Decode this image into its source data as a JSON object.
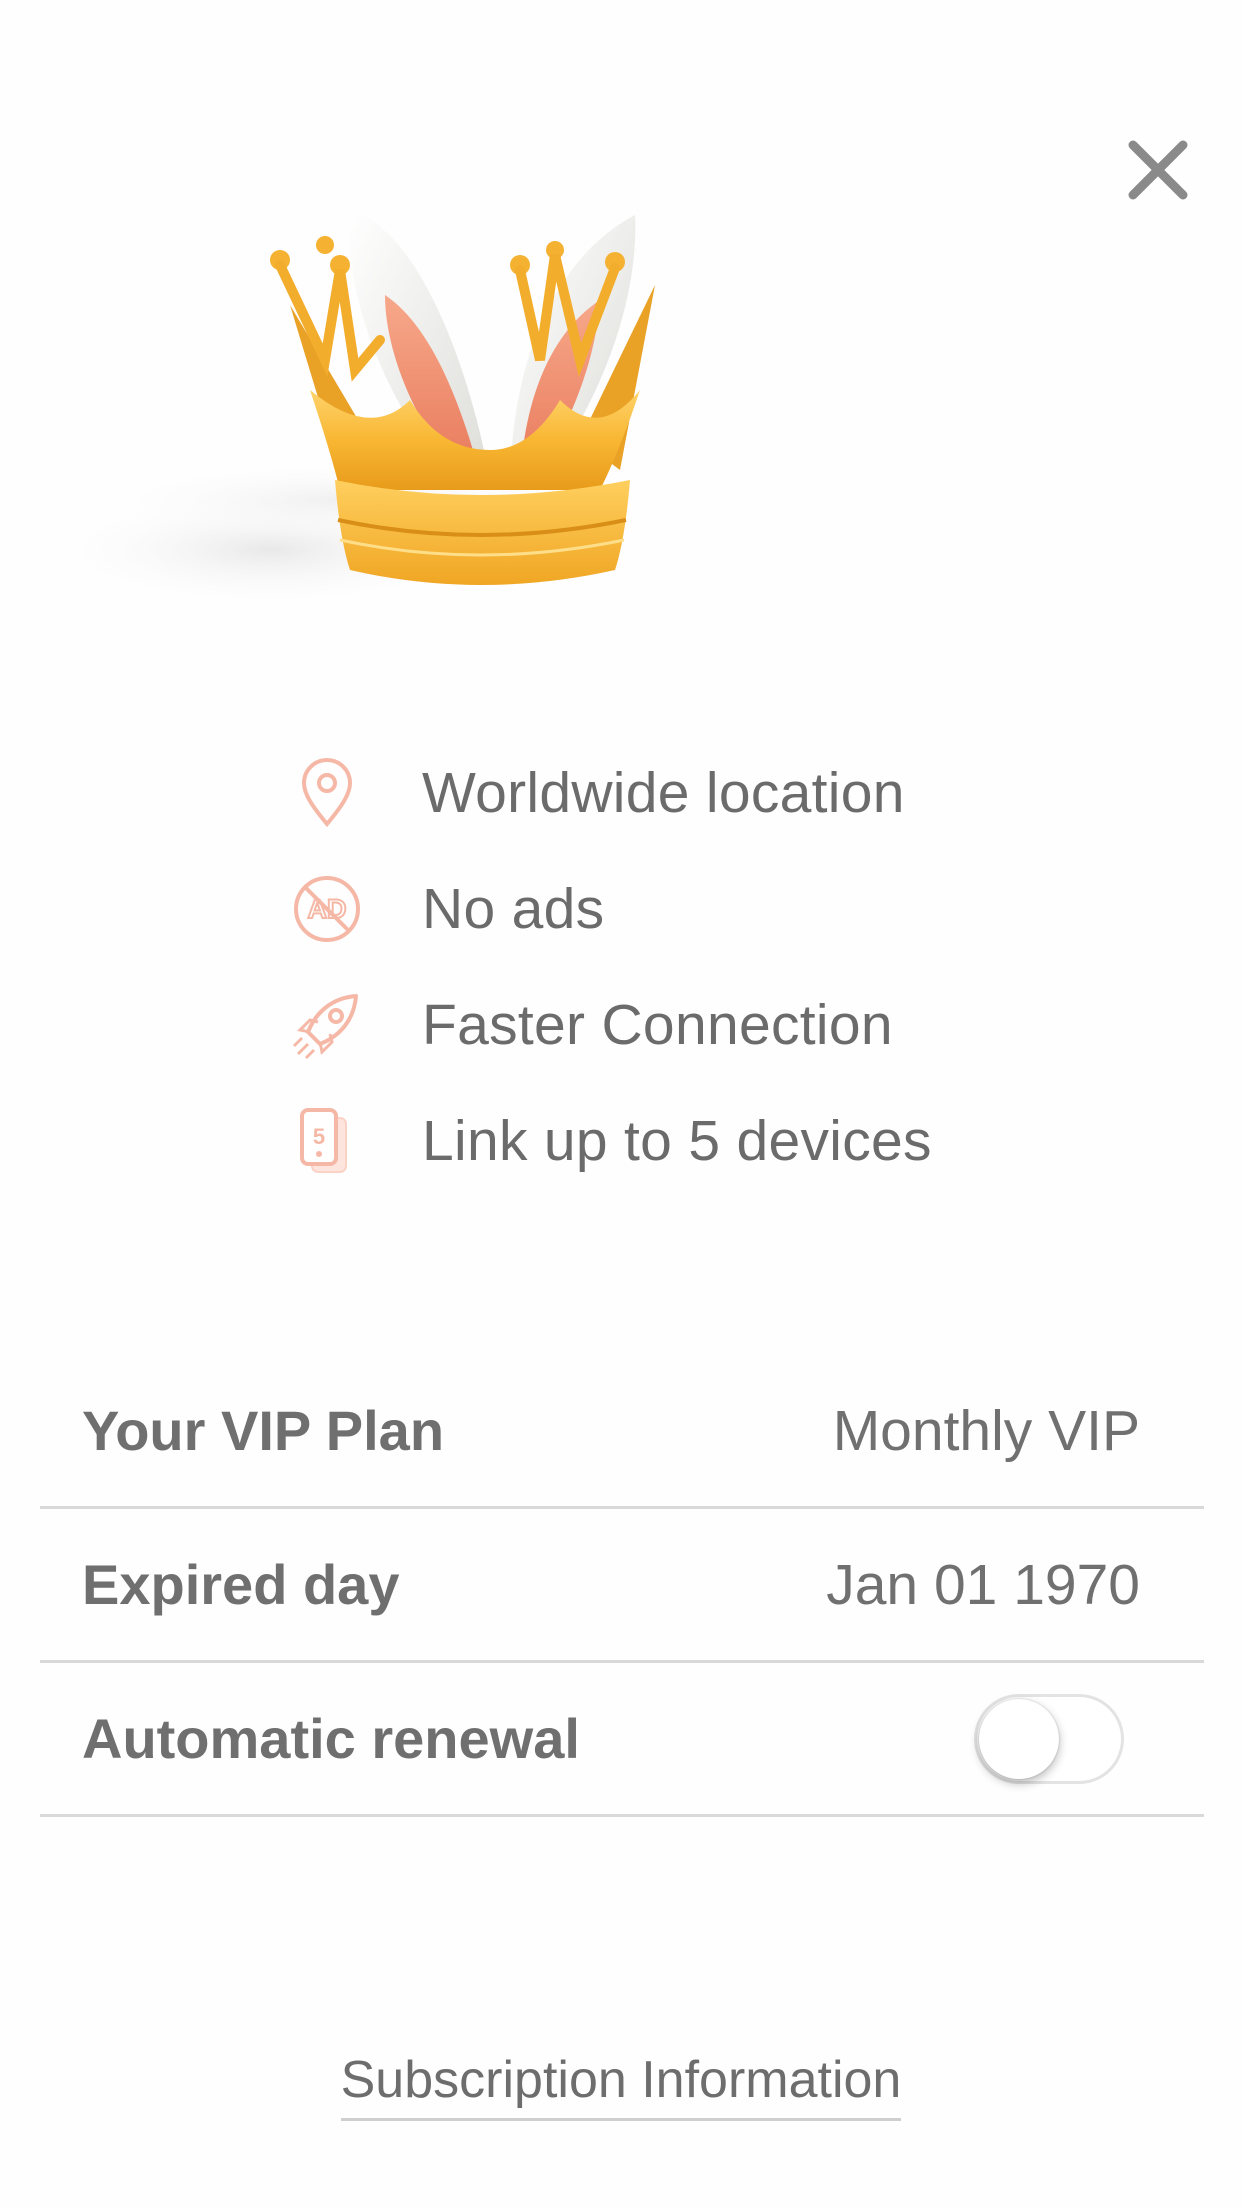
{
  "close": {
    "icon": "close-icon"
  },
  "hero": {
    "image": "crown-with-bunny-ears"
  },
  "features": [
    {
      "icon": "location-pin-icon",
      "label": "Worldwide location"
    },
    {
      "icon": "no-ads-icon",
      "label": "No ads"
    },
    {
      "icon": "rocket-icon",
      "label": "Faster Connection"
    },
    {
      "icon": "devices-icon",
      "label": "Link up to 5 devices"
    }
  ],
  "plan": {
    "label": "Your VIP Plan",
    "value": "Monthly VIP"
  },
  "expiry": {
    "label": "Expired day",
    "value": "Jan 01 1970"
  },
  "renewal": {
    "label": "Automatic renewal",
    "enabled": false
  },
  "subscription_link": "Subscription Information",
  "colors": {
    "icon_accent": "#f6b8a6",
    "text": "#6b6b6b",
    "divider": "#d9d9d9",
    "crown_gold": "#f7b733"
  }
}
